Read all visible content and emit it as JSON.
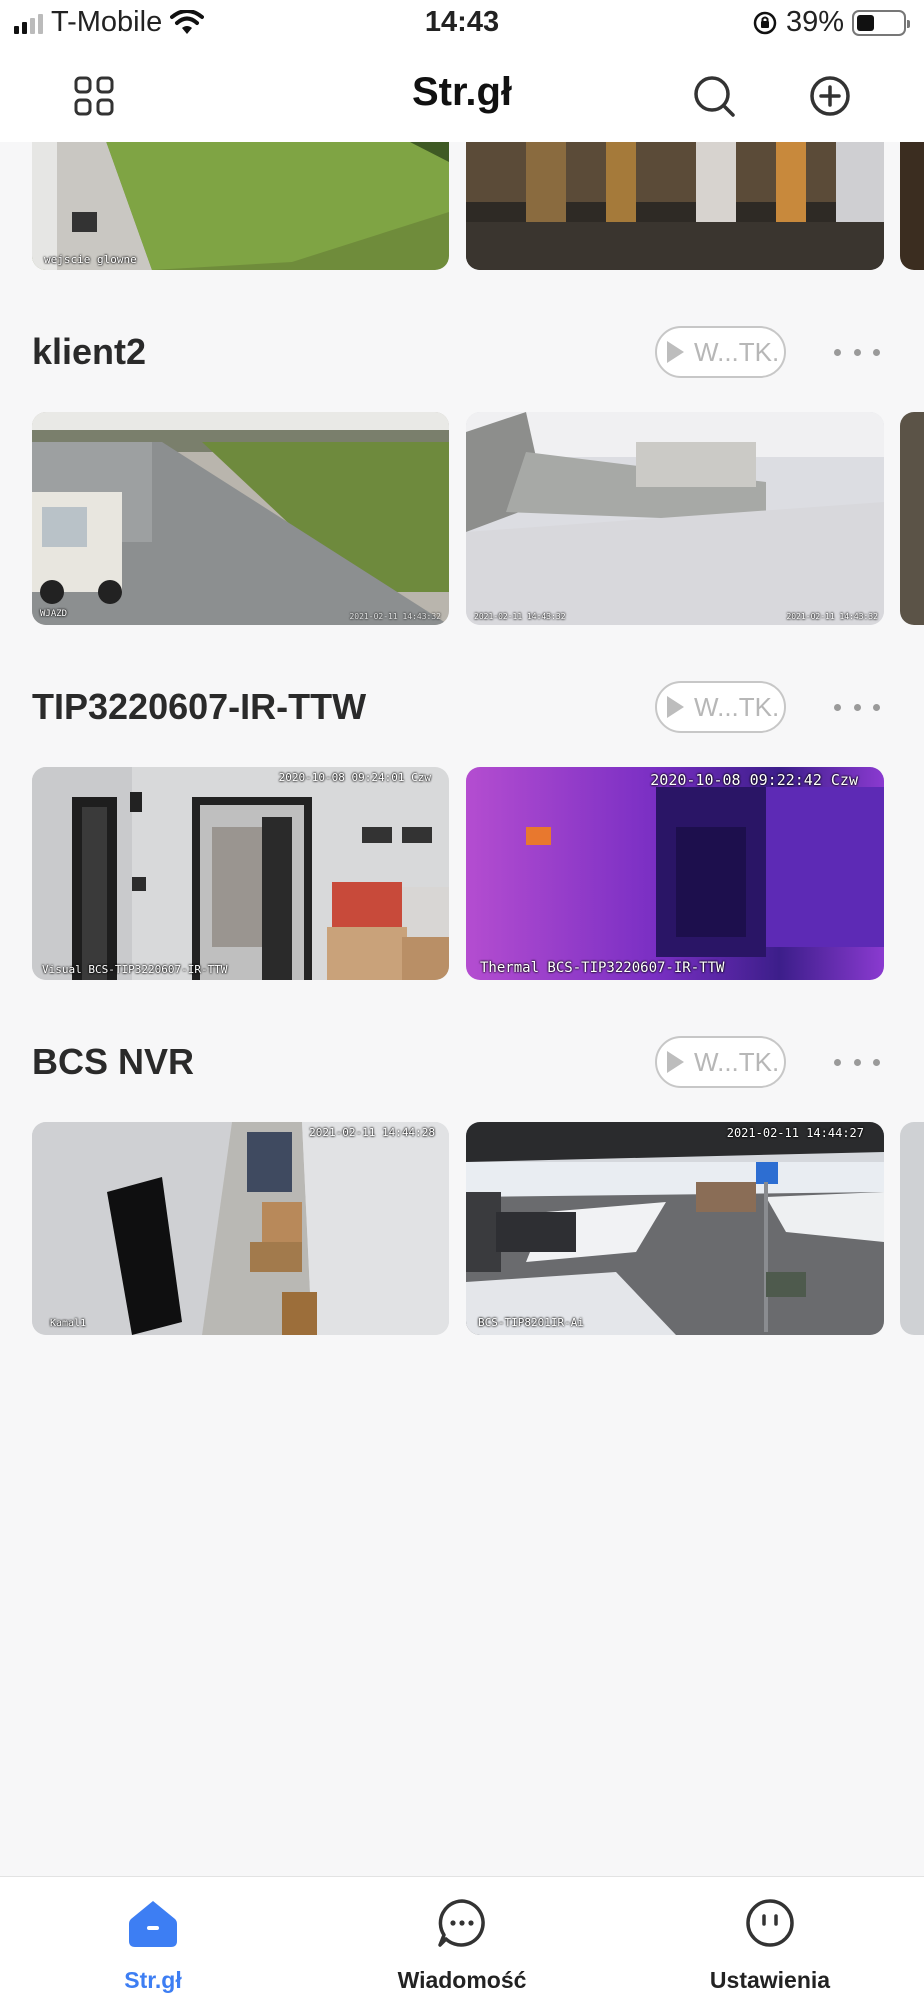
{
  "status_bar": {
    "carrier": "T-Mobile",
    "time": "14:43",
    "battery": "39%"
  },
  "header": {
    "title": "Str.gł"
  },
  "groups": [
    {
      "name": "klient2",
      "play_label": "W...TK.",
      "cameras": [
        {
          "overlay_left": "WJAZD",
          "overlay_right": "2021-02-11 14:43:32"
        },
        {
          "overlay_left": "2021-02-11 14:43:32",
          "overlay_right": "2021-02-11 14:43:32"
        }
      ]
    },
    {
      "name": "TIP3220607-IR-TTW",
      "play_label": "W...TK.",
      "cameras": [
        {
          "timestamp": "2020-10-08 09:24:01 Czw",
          "caption": "Visual BCS-TIP3220607-IR-TTW"
        },
        {
          "timestamp": "2020-10-08 09:22:42 Czw",
          "caption": "Thermal BCS-TIP3220607-IR-TTW"
        }
      ]
    },
    {
      "name": "BCS NVR",
      "play_label": "W...TK.",
      "cameras": [
        {
          "timestamp": "2021-02-11 14:44:28",
          "caption": "Kamal1"
        },
        {
          "timestamp": "2021-02-11 14:44:27",
          "caption": "BCS-TIP8201IR-Ai"
        }
      ]
    }
  ],
  "top_row": {
    "caption_left": "wejscie glowne"
  },
  "tabs": [
    {
      "label": "Str.gł",
      "icon": "home-icon",
      "active": true
    },
    {
      "label": "Wiadomość",
      "icon": "message-icon",
      "active": false
    },
    {
      "label": "Ustawienia",
      "icon": "settings-face-icon",
      "active": false
    }
  ],
  "colors": {
    "accent": "#3d7ef3"
  }
}
